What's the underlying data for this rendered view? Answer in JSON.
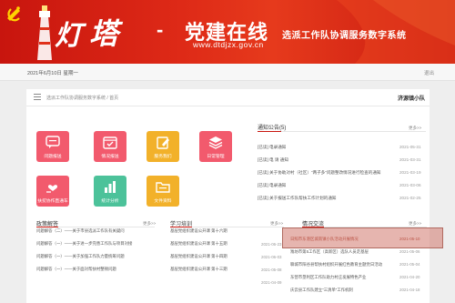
{
  "banner": {
    "logo_char_1": "灯",
    "logo_char_2": "塔",
    "logo_dash": "-",
    "logo_main": "党建在线",
    "logo_url": "www.dtdjzx.gov.cn",
    "logo_subtitle": "选派工作队协调服务数字系统"
  },
  "datebar": {
    "date": "2021年6月10日 星期一",
    "logout": "退出"
  },
  "crumbbar": {
    "breadcrumb": "选派工作队协调服务数字系统 / 首页",
    "team": "济源镇小队"
  },
  "tiles": [
    {
      "label": "问题报送",
      "color": "#f25a6d",
      "icon": "message-icon"
    },
    {
      "label": "情况报送",
      "color": "#f25a6d",
      "icon": "calendar-icon"
    },
    {
      "label": "服务我们",
      "color": "#f2b12a",
      "icon": "pen-icon"
    },
    {
      "label": "日常管理",
      "color": "#f25a6d",
      "icon": "stack-icon"
    },
    {
      "label": "扶贫协作直通车",
      "color": "#f25a6d",
      "icon": "hand-heart-icon"
    },
    {
      "label": "统计分析",
      "color": "#4cc29a",
      "icon": "chart-icon"
    },
    {
      "label": "文件资料",
      "color": "#f2b12a",
      "icon": "folder-icon"
    }
  ],
  "notice": {
    "title": "通知公告",
    "count": "(5)",
    "more": "更多>>",
    "items": [
      {
        "text": "[已读] 电录通知",
        "date": "2021-05-31"
      },
      {
        "text": "[已读] 电 请 通知",
        "date": "2021-03-31"
      },
      {
        "text": "[已读] 关于协助对村（社区）“两子多”问题整改情况进行检查的通知",
        "date": "2021-03-19"
      },
      {
        "text": "[已读] 电录通知",
        "date": "2021-03-06"
      },
      {
        "text": "[已读] 关于报送工作队帮扶工作计划的通知",
        "date": "2021-02-25"
      }
    ]
  },
  "policy": {
    "title": "政策解答",
    "more": "更多>>",
    "items": [
      "问题解答（二）——关于市县选派工作队有关疑问",
      "问题解答（一）——关于进一步完善工作队与项目对接",
      "问题解答（一）——关于加强工作队力量统筹问题",
      "问题解答（一）——关于面对帮扶村整顿问题"
    ]
  },
  "study": {
    "title": "学习培训",
    "more": "更多>>",
    "items": [
      {
        "text": "基层党组织建设公开课 第十六期",
        "date": "2021-06-23"
      },
      {
        "text": "基层党组织建设公开课 第十五期",
        "date": "2021-06-03"
      },
      {
        "text": "基层党组织建设公开课 第十四期",
        "date": "2021-05-08"
      },
      {
        "text": "基层党组织建设公开课 第十三期",
        "date": "2021-04-09"
      }
    ]
  },
  "situation": {
    "title": "情况交流",
    "more": "更多>>",
    "items": [
      {
        "text": "日照市东港区城南镇小队活动开展情况",
        "date": "2021-05-10"
      },
      {
        "text": "潍坊市第5工作区（高新区）选队人员走基层",
        "date": "2021-05-06"
      },
      {
        "text": "聊城市阳谷县帮扶村组织开展红色教育主题党日活动",
        "date": "2021-05-04"
      },
      {
        "text": "东营市垦利区工作队助力村庄发展特色产业",
        "date": "2021-04-20"
      },
      {
        "text": "庆云县工作队建立“三清单”工作机制",
        "date": "2021-04-18"
      }
    ]
  },
  "colors": {
    "brand_red": "#c8150e",
    "highlight": "#d2786e"
  }
}
